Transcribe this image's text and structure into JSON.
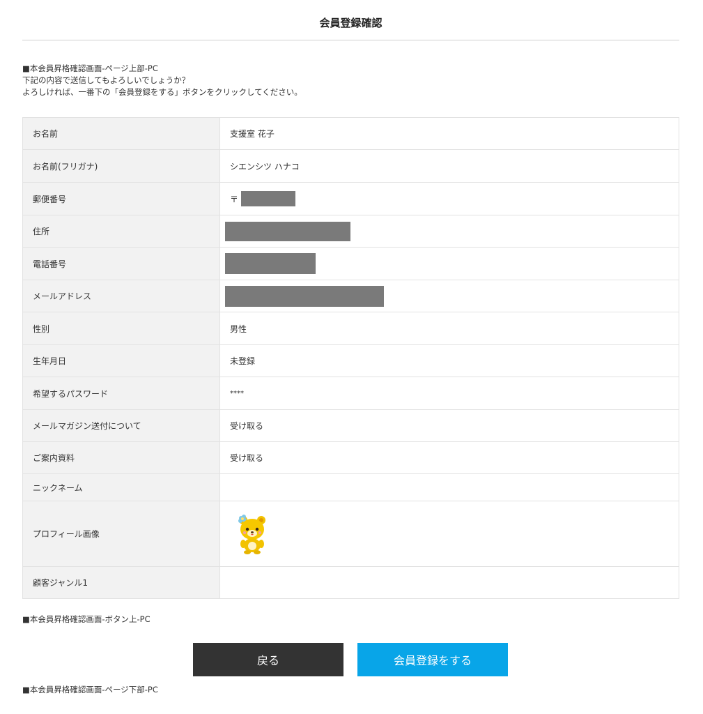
{
  "page": {
    "title": "会員登録確認",
    "note_top": "■本会員昇格確認画面-ページ上部-PC",
    "intro_line1": "下記の内容で送信してもよろしいでしょうか？",
    "intro_line2": "よろしければ、一番下の「会員登録をする」ボタンをクリックしてください。",
    "note_above_buttons": "■本会員昇格確認画面-ボタン上-PC",
    "note_bottom": "■本会員昇格確認画面-ページ下部-PC"
  },
  "fields": {
    "name": {
      "label": "お名前",
      "value": "支援室 花子"
    },
    "name_kana": {
      "label": "お名前(フリガナ)",
      "value": "シエンシツ ハナコ"
    },
    "postal": {
      "label": "郵便番号",
      "prefix": "〒"
    },
    "address": {
      "label": "住所"
    },
    "phone": {
      "label": "電話番号"
    },
    "email": {
      "label": "メールアドレス"
    },
    "gender": {
      "label": "性別",
      "value": "男性"
    },
    "birthday": {
      "label": "生年月日",
      "value": "未登録"
    },
    "password": {
      "label": "希望するパスワード",
      "value": "****"
    },
    "mail_magazine": {
      "label": "メールマガジン送付について",
      "value": "受け取る"
    },
    "brochure": {
      "label": "ご案内資料",
      "value": "受け取る"
    },
    "nickname": {
      "label": "ニックネーム",
      "value": ""
    },
    "profile_image": {
      "label": "プロフィール画像",
      "icon": "bear-mascot-avatar"
    },
    "genre": {
      "label": "顧客ジャンル1",
      "value": ""
    }
  },
  "buttons": {
    "back_label": "戻る",
    "submit_label": "会員登録をする"
  },
  "colors": {
    "back_button": "#333333",
    "submit_button": "#08a5e8",
    "label_cell": "#f2f2f2",
    "redaction": "#7a7a7a"
  }
}
